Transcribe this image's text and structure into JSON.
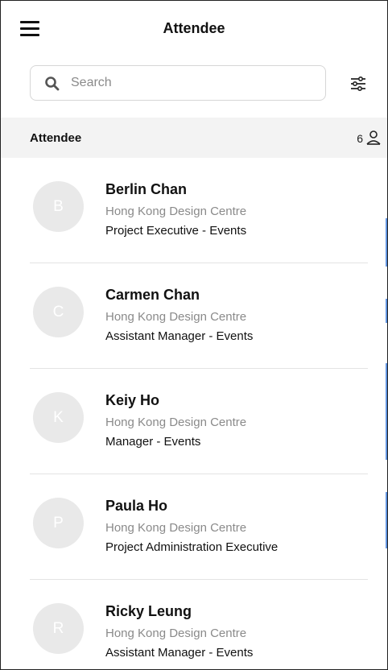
{
  "header": {
    "title": "Attendee"
  },
  "search": {
    "placeholder": "Search",
    "value": ""
  },
  "section": {
    "title": "Attendee",
    "count": "6"
  },
  "attendees": [
    {
      "initial": "B",
      "name": "Berlin Chan",
      "company": "Hong Kong Design Centre",
      "title": "Project Executive - Events"
    },
    {
      "initial": "C",
      "name": "Carmen Chan",
      "company": "Hong Kong Design Centre",
      "title": "Assistant Manager - Events"
    },
    {
      "initial": "K",
      "name": "Keiy Ho",
      "company": "Hong Kong Design Centre",
      "title": "Manager - Events"
    },
    {
      "initial": "P",
      "name": "Paula Ho",
      "company": "Hong Kong Design Centre",
      "title": "Project Administration Executive"
    },
    {
      "initial": "R",
      "name": "Ricky Leung",
      "company": "Hong Kong Design Centre",
      "title": "Assistant Manager - Events"
    }
  ],
  "icons": {
    "menu": "hamburger-menu-icon",
    "search": "search-icon",
    "filter": "filter-sliders-icon",
    "count": "person-icon"
  },
  "colors": {
    "section_background": "#f3f3f3",
    "avatar_background": "#e9e9e9",
    "secondary_text": "#8a8a8a",
    "index_accent": "#2a6fd6"
  }
}
